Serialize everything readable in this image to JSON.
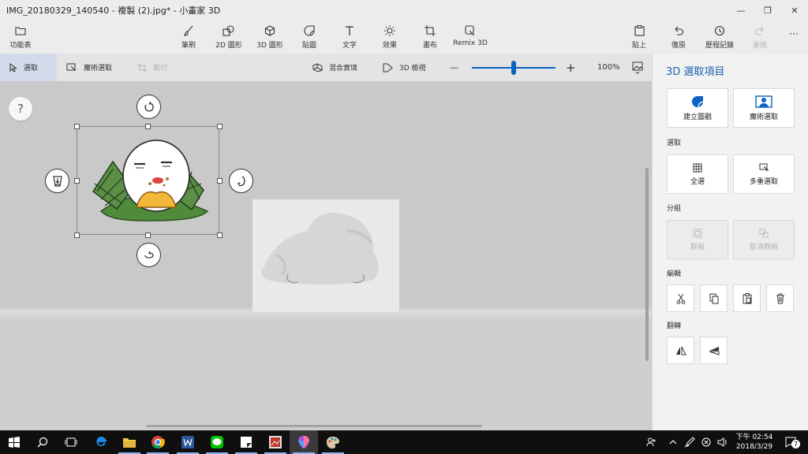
{
  "window": {
    "title": "IMG_20180329_140540 - 複製 (2).jpg* - 小畫家 3D",
    "minimize": "—",
    "maximize": "❐",
    "close": "✕"
  },
  "ribbon": {
    "menu": "功能表",
    "brushes": "筆刷",
    "shapes2d": "2D 圖形",
    "shapes3d": "3D 圖形",
    "stickers": "貼圖",
    "text": "文字",
    "effects": "效果",
    "canvas": "畫布",
    "remix3d": "Remix 3D",
    "paste": "貼上",
    "undo": "復原",
    "history": "歷程記錄",
    "redo": "重做",
    "more": "···"
  },
  "toolbar": {
    "select": "選取",
    "magic_select": "魔術選取",
    "crop": "裁切",
    "mixed_reality": "混合實境",
    "view_3d": "3D 檢視",
    "zoom_out": "—",
    "zoom_in": "+",
    "zoom_value": "100%",
    "zoom_fraction": 0.5
  },
  "canvas": {
    "help": "?"
  },
  "panel": {
    "title": "3D 選取項目",
    "make_sticker": "建立圖戳",
    "magic_select": "魔術選取",
    "section_select": "選取",
    "select_all": "全選",
    "multi_select": "多重選取",
    "section_group": "分組",
    "group": "群組",
    "ungroup": "取消群組",
    "section_edit": "編輯",
    "section_flip": "翻轉"
  },
  "taskbar": {
    "time": "下午 02:54",
    "date": "2018/3/29",
    "notifications": "7"
  },
  "colors": {
    "accent": "#0b63c3",
    "panel_title": "#1a5fb4",
    "taskbar": "#0f0f0f"
  }
}
